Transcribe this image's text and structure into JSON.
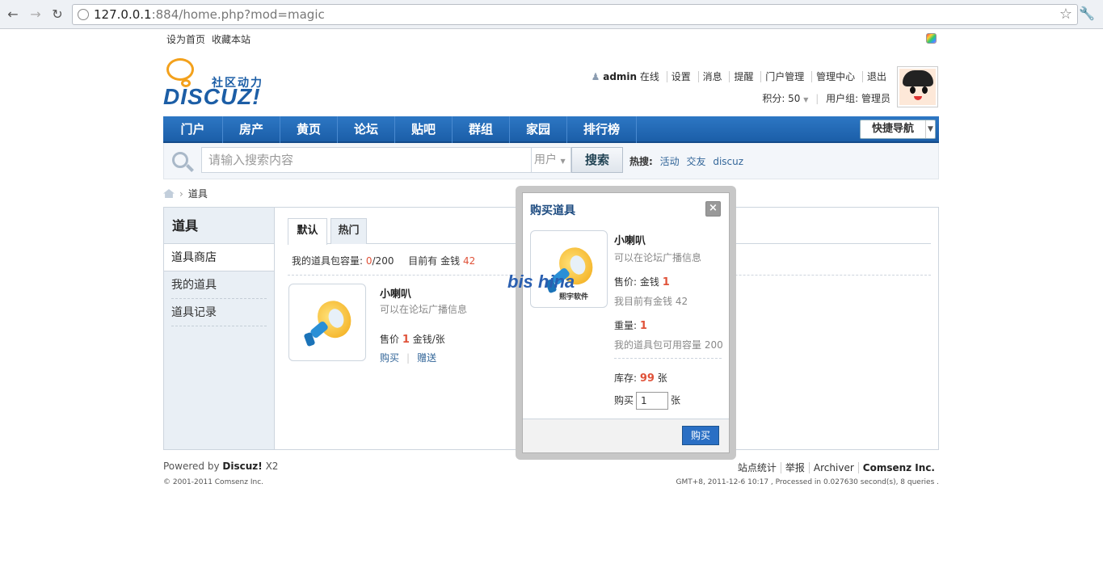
{
  "browser": {
    "url_host": "127.0.0.1",
    "url_rest": ":884/home.php?mod=magic"
  },
  "toplinks": [
    "设为首页",
    "收藏本站"
  ],
  "logo": {
    "tagline": "社区动力",
    "brand": "DISCUZ!"
  },
  "userbar": {
    "username": "admin",
    "status": "在线",
    "links": [
      "设置",
      "消息",
      "提醒",
      "门户管理",
      "管理中心",
      "退出"
    ],
    "points_label": "积分: 50",
    "usergroup": "用户组: 管理员"
  },
  "mainnav": {
    "items": [
      "门户",
      "房产",
      "黄页",
      "论坛",
      "贴吧",
      "群组",
      "家园",
      "排行榜"
    ],
    "quicknav": "快捷导航"
  },
  "search": {
    "placeholder": "请输入搜索内容",
    "type": "用户",
    "button": "搜索",
    "hot_label": "热搜:",
    "hot_keywords": [
      "活动",
      "交友",
      "discuz"
    ]
  },
  "breadcrumb": {
    "current": "道具"
  },
  "sidebar": {
    "title": "道具",
    "items": [
      "道具商店",
      "我的道具",
      "道具记录"
    ]
  },
  "tabs": [
    "默认",
    "热门"
  ],
  "capacity": {
    "label": "我的道具包容量:",
    "used": "0",
    "total": "/200",
    "money_label": "目前有 金钱",
    "money": "42"
  },
  "item": {
    "name": "小喇叭",
    "desc": "可以在论坛广播信息",
    "price_label": "售价",
    "price": "1",
    "price_unit": "金钱/张",
    "buy": "购买",
    "gift": "赠送"
  },
  "footer": {
    "powered_label": "Powered by",
    "powered_brand": "Discuz!",
    "powered_version": "X2",
    "copyright": "© 2001-2011 Comsenz Inc.",
    "links": [
      "站点统计",
      "举报",
      "Archiver",
      "Comsenz Inc."
    ],
    "stats": "GMT+8, 2011-12-6 10:17 , Processed in 0.027630 second(s), 8 queries ."
  },
  "modal": {
    "title": "购买道具",
    "close": "×",
    "name": "小喇叭",
    "desc": "可以在论坛广播信息",
    "price_label": "售价: 金钱",
    "price": "1",
    "my_money": "我目前有金钱 42",
    "weight_label": "重量:",
    "weight": "1",
    "capacity": "我的道具包可用容量 200",
    "stock_label": "库存:",
    "stock": "99",
    "stock_unit": "张",
    "qty_label": "购买",
    "qty": "1",
    "qty_unit": "张",
    "buy_button": "购买"
  },
  "watermark": {
    "text": "bis hina",
    "sub": "熙宇软件"
  },
  "colors": {
    "nav_blue": "#1b5ea8",
    "accent_red": "#e0533a",
    "link_blue": "#336699"
  }
}
